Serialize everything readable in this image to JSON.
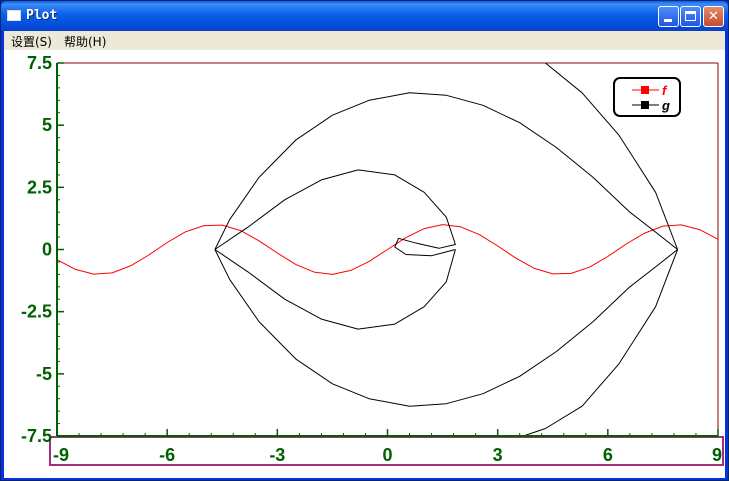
{
  "window": {
    "title": "Plot",
    "buttons": {
      "minimize": "minimize",
      "maximize": "maximize",
      "close": "close"
    }
  },
  "menu": [
    {
      "label": "设置(S)"
    },
    {
      "label": "帮助(H)"
    }
  ],
  "colors": {
    "axis": "#005f00",
    "frame": "#8b0000",
    "series_f": "#ff0000",
    "series_g": "#000000",
    "selection_box": "#a0307a"
  },
  "chart_data": {
    "type": "line",
    "xlim": [
      -9,
      9
    ],
    "ylim": [
      -7.5,
      7.5
    ],
    "x_ticks": [
      "-9",
      "-6",
      "-3",
      "0",
      "3",
      "6",
      "9"
    ],
    "y_ticks": [
      "7.5",
      "5",
      "2.5",
      "0",
      "-2.5",
      "-5",
      "-7.5"
    ],
    "legend_position": "top-right",
    "series": [
      {
        "name": "f",
        "color": "#ff0000",
        "x": [
          -9,
          -8.5,
          -8,
          -7.5,
          -7,
          -6.5,
          -6,
          -5.5,
          -5,
          -4.5,
          -4,
          -3.5,
          -3,
          -2.5,
          -2,
          -1.5,
          -1,
          -0.5,
          0,
          0.5,
          1,
          1.5,
          2,
          2.5,
          3,
          3.5,
          4,
          4.5,
          5,
          5.5,
          6,
          6.5,
          7,
          7.5,
          8,
          8.5,
          9
        ],
        "y": [
          -0.41,
          -0.8,
          -0.99,
          -0.94,
          -0.66,
          -0.22,
          0.28,
          0.71,
          0.96,
          0.98,
          0.76,
          0.35,
          -0.14,
          -0.6,
          -0.91,
          -1.0,
          -0.84,
          -0.48,
          0,
          0.48,
          0.84,
          1.0,
          0.91,
          0.6,
          0.14,
          -0.35,
          -0.76,
          -0.98,
          -0.96,
          -0.71,
          -0.28,
          0.22,
          0.66,
          0.94,
          0.99,
          0.8,
          0.41
        ]
      },
      {
        "name": "g",
        "color": "#000000",
        "segments": [
          {
            "x": [
              -4.7,
              -4.3,
              -3.5,
              -2.5,
              -1.5,
              -0.5,
              0.6,
              1.6,
              2.6,
              3.6,
              4.6,
              5.6,
              6.6,
              7.3,
              7.9
            ],
            "y": [
              0,
              1.2,
              2.9,
              4.4,
              5.4,
              6.0,
              6.3,
              6.2,
              5.8,
              5.1,
              4.1,
              2.9,
              1.5,
              0.7,
              0
            ]
          },
          {
            "x": [
              -4.7,
              -4.3,
              -3.5,
              -2.5,
              -1.5,
              -0.5,
              0.6,
              1.6,
              2.6,
              3.6,
              4.6,
              5.6,
              6.6,
              7.3,
              7.9
            ],
            "y": [
              0,
              -1.2,
              -2.9,
              -4.4,
              -5.4,
              -6.0,
              -6.3,
              -6.2,
              -5.8,
              -5.1,
              -4.1,
              -2.9,
              -1.5,
              -0.7,
              0
            ]
          },
          {
            "x": [
              -4.7,
              -3.8,
              -2.8,
              -1.8,
              -0.8,
              0.2,
              1.0,
              1.6,
              1.85,
              1.4,
              0.8,
              0.3,
              0.2,
              0.5,
              1.2,
              1.85
            ],
            "y": [
              0,
              0.9,
              2.0,
              2.8,
              3.2,
              3.0,
              2.3,
              1.3,
              0.2,
              0.05,
              0.25,
              0.45,
              0.1,
              -0.2,
              -0.25,
              0
            ]
          },
          {
            "x": [
              -4.7,
              -3.8,
              -2.8,
              -1.8,
              -0.8,
              0.2,
              1.0,
              1.6,
              1.85
            ],
            "y": [
              0,
              -0.9,
              -2.0,
              -2.8,
              -3.2,
              -3.0,
              -2.3,
              -1.3,
              0
            ]
          },
          {
            "x": [
              4.3,
              5.3,
              6.3,
              7.3,
              7.9
            ],
            "y": [
              7.5,
              6.3,
              4.6,
              2.3,
              0
            ]
          },
          {
            "x": [
              7.9,
              7.3,
              6.3,
              5.3,
              4.3,
              3.7
            ],
            "y": [
              0,
              -2.3,
              -4.6,
              -6.3,
              -7.2,
              -7.5
            ]
          }
        ]
      }
    ]
  }
}
